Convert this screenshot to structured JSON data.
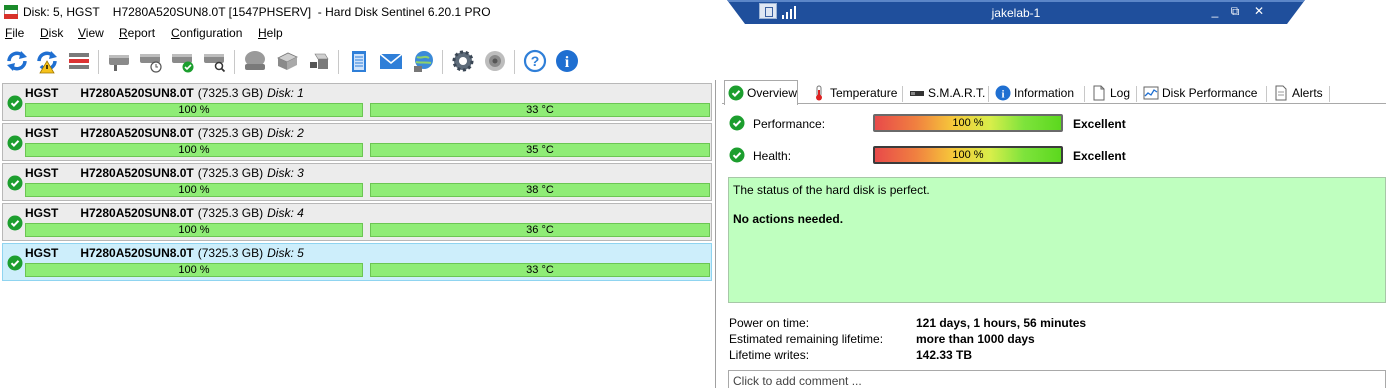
{
  "window": {
    "title": "Disk: 5, HGST    H7280A520SUN8.0T [1547PHSERV]  - Hard Disk Sentinel 6.20.1 PRO"
  },
  "remote": {
    "connection_name": "jakelab-1",
    "minimize": "_",
    "restore": "⧉",
    "close": "✕"
  },
  "menu": [
    {
      "accel": "F",
      "rest": "ile"
    },
    {
      "accel": "D",
      "rest": "isk"
    },
    {
      "accel": "V",
      "rest": "iew"
    },
    {
      "accel": "R",
      "rest": "eport"
    },
    {
      "accel": "C",
      "rest": "onfiguration"
    },
    {
      "accel": "H",
      "rest": "elp"
    }
  ],
  "toolbar": {
    "icons": [
      "refresh-icon",
      "refresh-warning-icon",
      "disk-list-icon",
      "disk-surface-icon",
      "disk-schedule-icon",
      "disk-check-icon",
      "disk-search-icon",
      "disk-gray-icon",
      "disk-stack-icon",
      "disk-usb-icon",
      "report-notepad-icon",
      "email-report-icon",
      "network-report-icon",
      "settings-gear-icon",
      "sound-icon",
      "help-icon",
      "info-icon"
    ]
  },
  "disks": [
    {
      "vendor": "HGST",
      "model": "H7280A520SUN8.0T",
      "size": "(7325.3 GB)",
      "index": "Disk: 1",
      "health": "100 %",
      "temperature": "33 °C",
      "selected": false
    },
    {
      "vendor": "HGST",
      "model": "H7280A520SUN8.0T",
      "size": "(7325.3 GB)",
      "index": "Disk: 2",
      "health": "100 %",
      "temperature": "35 °C",
      "selected": false
    },
    {
      "vendor": "HGST",
      "model": "H7280A520SUN8.0T",
      "size": "(7325.3 GB)",
      "index": "Disk: 3",
      "health": "100 %",
      "temperature": "38 °C",
      "selected": false
    },
    {
      "vendor": "HGST",
      "model": "H7280A520SUN8.0T",
      "size": "(7325.3 GB)",
      "index": "Disk: 4",
      "health": "100 %",
      "temperature": "36 °C",
      "selected": false
    },
    {
      "vendor": "HGST",
      "model": "H7280A520SUN8.0T",
      "size": "(7325.3 GB)",
      "index": "Disk: 5",
      "health": "100 %",
      "temperature": "33 °C",
      "selected": true
    }
  ],
  "tabs": [
    {
      "label": "Overview",
      "icon": "check-icon",
      "active": true
    },
    {
      "label": "Temperature",
      "icon": "thermometer-icon",
      "active": false
    },
    {
      "label": "S.M.A.R.T.",
      "icon": "smart-icon",
      "active": false
    },
    {
      "label": "Information",
      "icon": "info-icon",
      "active": false
    },
    {
      "label": "Log",
      "icon": "log-icon",
      "active": false
    },
    {
      "label": "Disk Performance",
      "icon": "performance-chart-icon",
      "active": false
    },
    {
      "label": "Alerts",
      "icon": "alerts-icon",
      "active": false
    }
  ],
  "overview": {
    "performance": {
      "label": "Performance:",
      "value": "100 %",
      "rating": "Excellent"
    },
    "health": {
      "label": "Health:",
      "value": "100 %",
      "rating": "Excellent"
    },
    "status_text": "The status of the hard disk is perfect.",
    "status_action": "No actions needed.",
    "info": [
      {
        "label": "Power on time:",
        "value": "121 days, 1 hours, 56 minutes"
      },
      {
        "label": "Estimated remaining lifetime:",
        "value": "more than 1000 days"
      },
      {
        "label": "Lifetime writes:",
        "value": "142.33 TB"
      }
    ],
    "comment_placeholder": "Click to add comment ..."
  },
  "colors": {
    "ok_green": "#1c9e2e",
    "bar_green": "#8fec76",
    "status_bg": "#bfffbf",
    "selected_row": "#cdeefb",
    "remote_bar": "#1f4f9c"
  }
}
